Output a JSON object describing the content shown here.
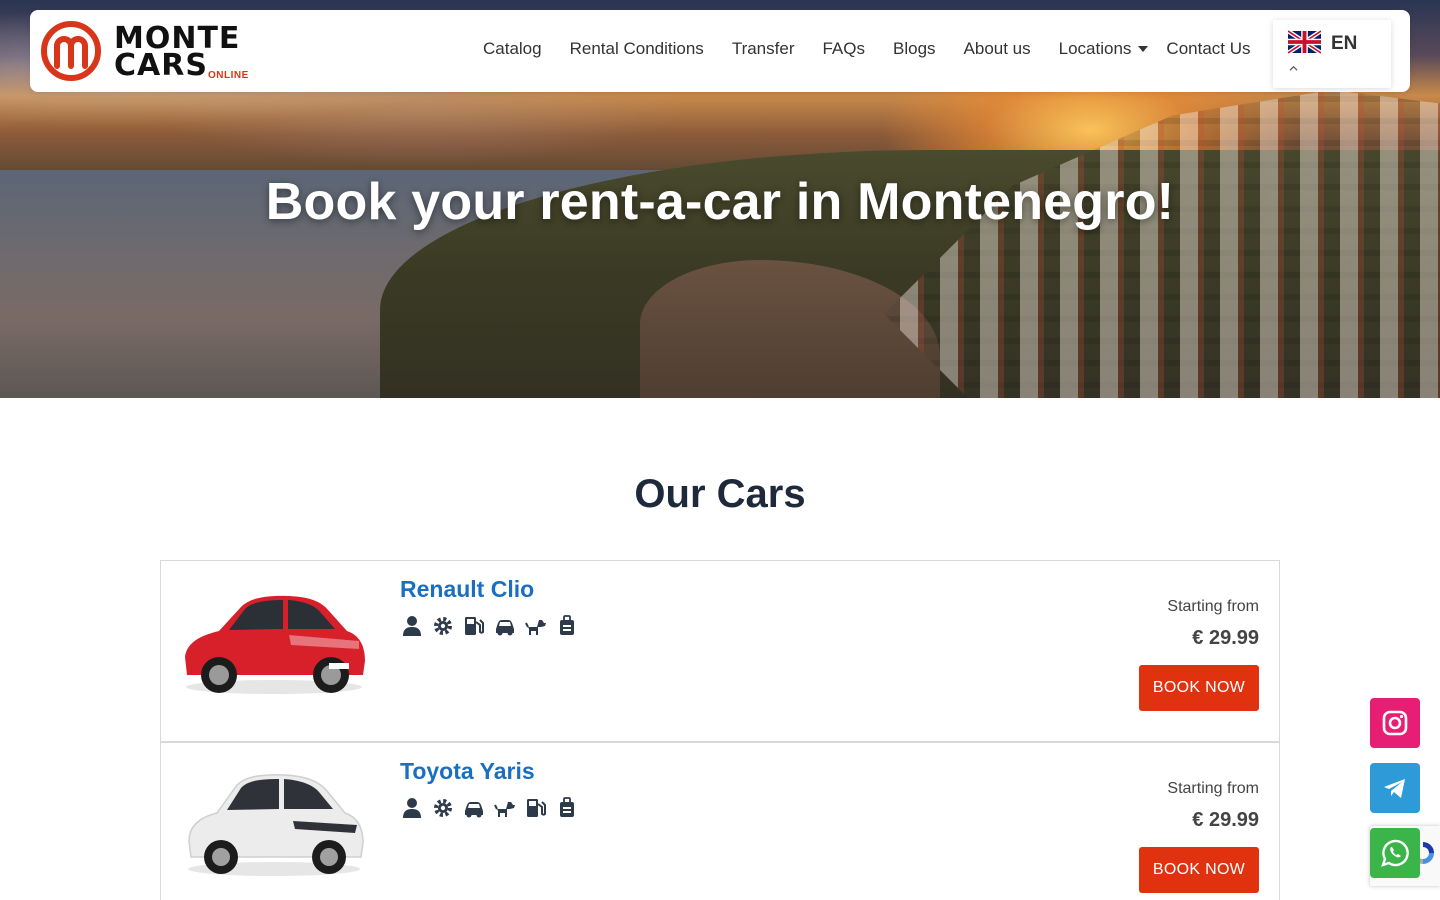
{
  "header": {
    "logo": {
      "line1": "MONTE",
      "line2": "CARS",
      "tag": "ONLINE"
    },
    "nav": [
      {
        "label": "Catalog"
      },
      {
        "label": "Rental Conditions"
      },
      {
        "label": "Transfer"
      },
      {
        "label": "FAQs"
      },
      {
        "label": "Blogs"
      },
      {
        "label": "About us"
      },
      {
        "label": "Locations"
      },
      {
        "label": "Contact Us"
      }
    ],
    "language": {
      "code": "EN",
      "flag_icon": "uk-flag-icon"
    }
  },
  "hero": {
    "title": "Book your rent-a-car in Montenegro!"
  },
  "main": {
    "section_title": "Our Cars",
    "cars": [
      {
        "name": "Renault Clio",
        "color": "#d8202a",
        "features": [
          "user-icon",
          "gear-icon",
          "fuel-icon",
          "car-icon",
          "pet-icon",
          "luggage-icon"
        ],
        "price_label": "Starting from",
        "price": "€ 29.99",
        "book_label": "BOOK NOW"
      },
      {
        "name": "Toyota Yaris",
        "color": "#eeeeee",
        "features": [
          "user-icon",
          "gear-icon",
          "car-icon",
          "pet-icon",
          "fuel-icon",
          "luggage-icon"
        ],
        "price_label": "Starting from",
        "price": "€ 29.99",
        "book_label": "BOOK NOW"
      }
    ]
  },
  "social": [
    {
      "name": "instagram-icon",
      "color": "#e61e74"
    },
    {
      "name": "telegram-icon",
      "color": "#2e9ad8"
    },
    {
      "name": "whatsapp-icon",
      "color": "#3bb54a"
    }
  ],
  "colors": {
    "accent": "#e0320f",
    "link": "#1a6fc0",
    "heading": "#1e2a3b"
  }
}
